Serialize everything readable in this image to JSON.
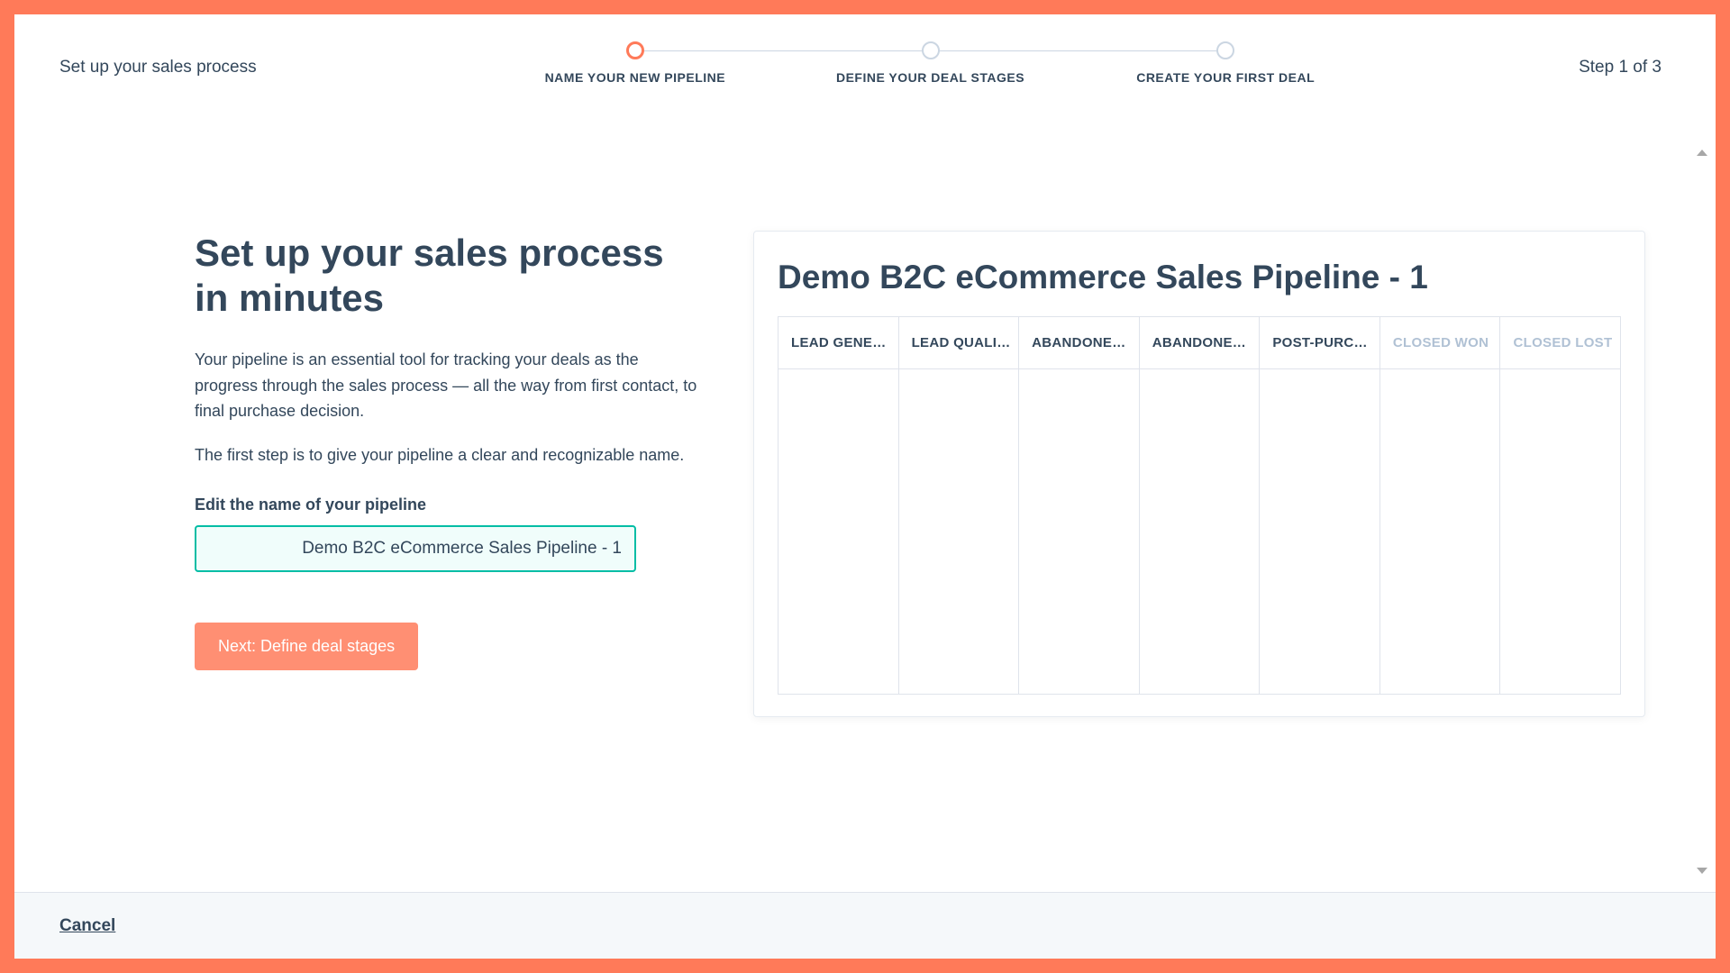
{
  "header": {
    "title": "Set up your sales process",
    "step_counter": "Step 1 of 3",
    "steps": [
      {
        "label": "NAME YOUR NEW PIPELINE"
      },
      {
        "label": "DEFINE YOUR DEAL STAGES"
      },
      {
        "label": "CREATE YOUR FIRST DEAL"
      }
    ]
  },
  "left": {
    "heading": "Set up your sales process in minutes",
    "paragraph1": "Your pipeline is an essential tool for tracking your deals as the progress through the sales process — all the way from first contact, to final purchase decision.",
    "paragraph2": "The first step is to give your pipeline a clear and recognizable name.",
    "field_label": "Edit the name of your pipeline",
    "input_value": "Demo B2C eCommerce Sales Pipeline - 1",
    "next_button": "Next: Define deal stages"
  },
  "preview": {
    "title": "Demo B2C eCommerce Sales Pipeline - 1",
    "stages": [
      {
        "label": "LEAD GENE…",
        "muted": false
      },
      {
        "label": "LEAD QUALI…",
        "muted": false
      },
      {
        "label": "ABANDONE…",
        "muted": false
      },
      {
        "label": "ABANDONE…",
        "muted": false
      },
      {
        "label": "POST-PURC…",
        "muted": false
      },
      {
        "label": "CLOSED WON",
        "muted": true
      },
      {
        "label": "CLOSED LOST",
        "muted": true
      }
    ]
  },
  "footer": {
    "cancel": "Cancel"
  }
}
